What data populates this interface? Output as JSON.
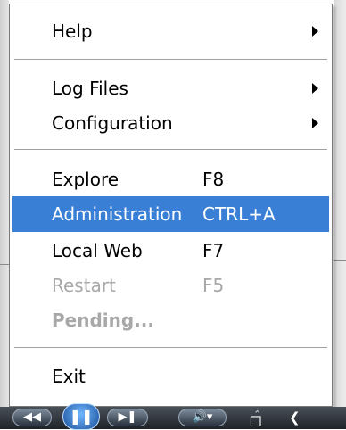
{
  "menu": {
    "help": {
      "label": "Help",
      "has_submenu": true
    },
    "log_files": {
      "label": "Log Files",
      "has_submenu": true
    },
    "configuration": {
      "label": "Configuration",
      "has_submenu": true
    },
    "explore": {
      "label": "Explore",
      "shortcut": "F8"
    },
    "administration": {
      "label": "Administration",
      "shortcut": "CTRL+A",
      "highlighted": true
    },
    "local_web": {
      "label": "Local Web",
      "shortcut": "F7"
    },
    "restart": {
      "label": "Restart",
      "shortcut": "F5",
      "disabled": true
    },
    "pending": {
      "label": "Pending...",
      "disabled": true
    },
    "exit": {
      "label": "Exit"
    }
  },
  "taskbar": {
    "icons": [
      "previous-icon",
      "pause-icon",
      "next-icon",
      "volume-icon",
      "chevron-up-icon",
      "restore-icon",
      "back-arrow-icon"
    ]
  },
  "colors": {
    "highlight": "#3a7fd6",
    "disabled_text": "#a8a8a8"
  }
}
